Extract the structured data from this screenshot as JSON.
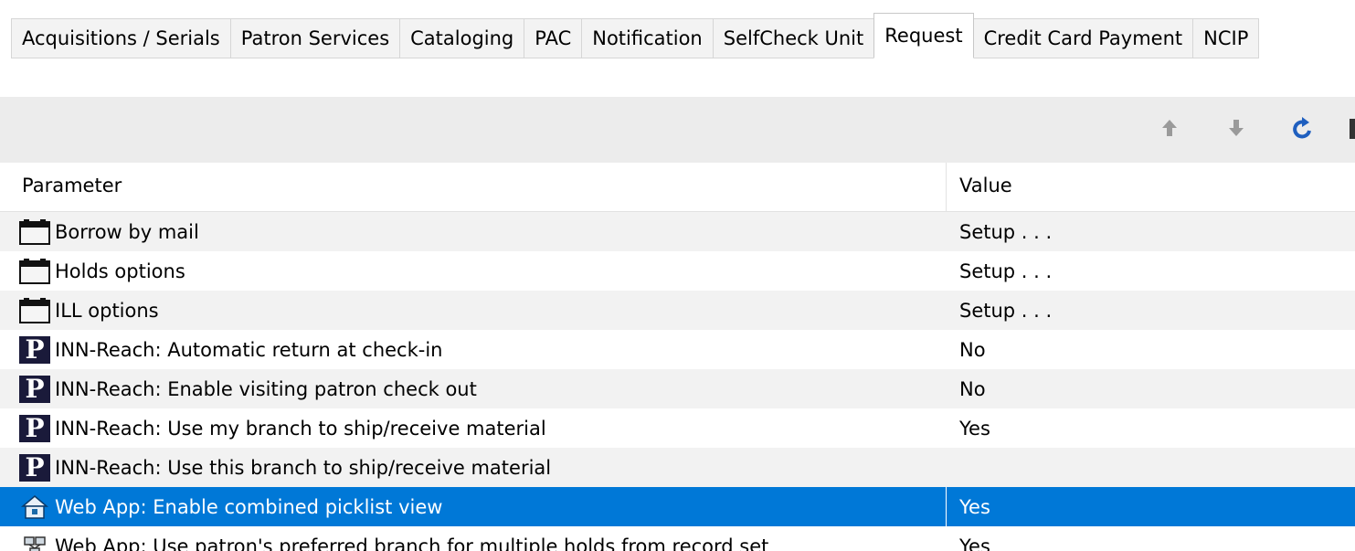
{
  "tabs": [
    {
      "label": "Acquisitions / Serials",
      "active": false
    },
    {
      "label": "Patron Services",
      "active": false
    },
    {
      "label": "Cataloging",
      "active": false
    },
    {
      "label": "PAC",
      "active": false
    },
    {
      "label": "Notification",
      "active": false
    },
    {
      "label": "SelfCheck Unit",
      "active": false
    },
    {
      "label": "Request",
      "active": true
    },
    {
      "label": "Credit Card Payment",
      "active": false
    },
    {
      "label": "NCIP",
      "active": false
    }
  ],
  "toolbar": {
    "icons": [
      "arrow-up-icon",
      "arrow-down-icon",
      "refresh-icon"
    ]
  },
  "grid": {
    "headers": {
      "parameter": "Parameter",
      "value": "Value"
    },
    "rows": [
      {
        "icon": "folder-icon",
        "parameter": "Borrow by mail",
        "value": "Setup . . ."
      },
      {
        "icon": "folder-icon",
        "parameter": "Holds options",
        "value": "Setup . . ."
      },
      {
        "icon": "folder-icon",
        "parameter": "ILL options",
        "value": "Setup . . ."
      },
      {
        "icon": "polaris-p-icon",
        "parameter": "INN-Reach: Automatic return at check-in",
        "value": "No"
      },
      {
        "icon": "polaris-p-icon",
        "parameter": "INN-Reach: Enable visiting patron check out",
        "value": "No"
      },
      {
        "icon": "polaris-p-icon",
        "parameter": "INN-Reach: Use my branch to ship/receive material",
        "value": "Yes"
      },
      {
        "icon": "polaris-p-icon",
        "parameter": "INN-Reach: Use this branch to ship/receive material",
        "value": ""
      },
      {
        "icon": "branch-house-icon",
        "parameter": "Web App: Enable combined picklist view",
        "value": "Yes",
        "selected": true
      },
      {
        "icon": "network-icon",
        "parameter": "Web App: Use patron's preferred branch for multiple holds from record set",
        "value": "Yes"
      }
    ]
  },
  "colors": {
    "selection": "#0078d7",
    "toolbar_bg": "#ececec",
    "row_alt": "#f2f2f2",
    "refresh_blue": "#1f5fbf",
    "arrow_gray": "#9a9a9a"
  }
}
